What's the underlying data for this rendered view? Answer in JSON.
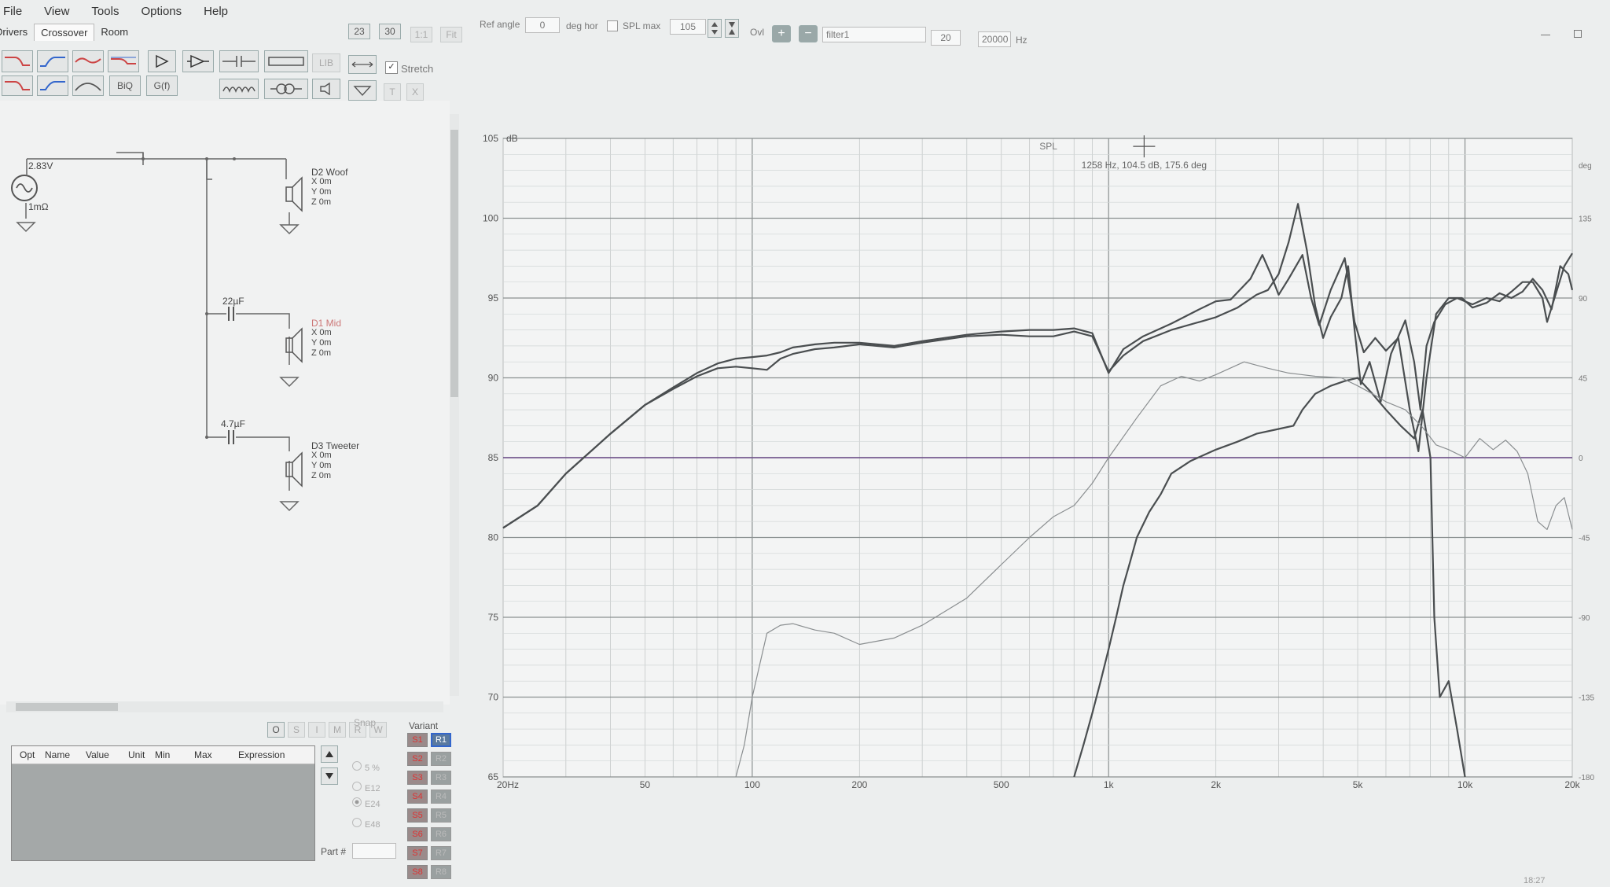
{
  "menu": [
    "File",
    "View",
    "Tools",
    "Options",
    "Help"
  ],
  "tabs": [
    "Drivers",
    "Crossover",
    "Room"
  ],
  "zoom_buttons": [
    "23",
    "30",
    "1:1",
    "Fit"
  ],
  "toolbar": {
    "biq": "BiQ",
    "gf": "G(f)",
    "lib": "LIB",
    "stretch": "Stretch",
    "t": "T",
    "x": "X"
  },
  "topbar": {
    "ref_angle_label": "Ref angle",
    "ref_angle": "0",
    "deg_hor": "deg hor",
    "spl_max_label": "SPL max",
    "spl_max": "105",
    "ovl": "Ovl",
    "filter": "filter1",
    "f_min": "20",
    "f_max": "20000",
    "hz": "Hz"
  },
  "schematic": {
    "source_v": "2.83V",
    "source_r": "1mΩ",
    "woof": {
      "name": "D2 Woof",
      "x": "X 0m",
      "y": "Y 0m",
      "z": "Z 0m"
    },
    "mid": {
      "name": "D1 Mid",
      "x": "X 0m",
      "y": "Y 0m",
      "z": "Z 0m",
      "cap": "22µF"
    },
    "tweet": {
      "name": "D3 Tweeter",
      "x": "X 0m",
      "y": "Y 0m",
      "z": "Z 0m",
      "cap": "4.7µF"
    }
  },
  "param_table": {
    "headers": [
      "Opt",
      "Name",
      "Value",
      "Unit",
      "Min",
      "Max",
      "Expression"
    ],
    "part_label": "Part #"
  },
  "snap": {
    "label": "Snap",
    "options": [
      "5 %",
      "E12",
      "E24",
      "E48"
    ],
    "selected": "E24"
  },
  "variant": {
    "label": "Variant",
    "s": [
      "S1",
      "S2",
      "S3",
      "S4",
      "S5",
      "S6",
      "S7",
      "S8"
    ],
    "r": [
      "R1",
      "R2",
      "R3",
      "R4",
      "R5",
      "R6",
      "R7",
      "R8"
    ]
  },
  "small_buttons": [
    "O",
    "S",
    "I",
    "M",
    "R",
    "W"
  ],
  "clock": "18:27",
  "colors": {
    "grid": "#9aa0a0",
    "trace_dark": "#4a4e50",
    "trace_light": "#8a8e90",
    "phase_line": "#6a4a88"
  },
  "chart_data": {
    "type": "line",
    "title": "SPL",
    "ylabel": "dB",
    "y2label": "deg",
    "xscale": "log",
    "xlim": [
      20,
      20000
    ],
    "ylim": [
      65,
      105
    ],
    "y2lim": [
      -180,
      180
    ],
    "x_ticks": [
      "20Hz",
      "50",
      "100",
      "200",
      "500",
      "1k",
      "2k",
      "5k",
      "10k",
      "20k"
    ],
    "y_ticks": [
      65,
      70,
      75,
      80,
      85,
      90,
      95,
      100,
      105
    ],
    "y2_ticks": [
      "-180",
      "-135",
      "-90",
      "-45",
      "0",
      "45",
      "90",
      "135",
      "deg"
    ],
    "cursor_readout": "1258 Hz, 104.5 dB, 175.6 deg",
    "cursor": {
      "freq": 1258,
      "db": 104.5
    },
    "grid": true,
    "series": [
      {
        "role": "spl_total_a",
        "style": "dark",
        "points": [
          [
            20,
            80.6
          ],
          [
            25,
            82
          ],
          [
            30,
            84
          ],
          [
            40,
            86.5
          ],
          [
            50,
            88.3
          ],
          [
            60,
            89.3
          ],
          [
            70,
            90.1
          ],
          [
            80,
            90.6
          ],
          [
            90,
            90.7
          ],
          [
            100,
            90.6
          ],
          [
            110,
            90.5
          ],
          [
            120,
            91.2
          ],
          [
            130,
            91.5
          ],
          [
            150,
            91.8
          ],
          [
            170,
            91.9
          ],
          [
            200,
            92.1
          ],
          [
            250,
            91.9
          ],
          [
            300,
            92.2
          ],
          [
            400,
            92.6
          ],
          [
            500,
            92.7
          ],
          [
            600,
            92.6
          ],
          [
            700,
            92.6
          ],
          [
            800,
            92.9
          ],
          [
            900,
            92.6
          ],
          [
            1000,
            90.4
          ],
          [
            1100,
            91.4
          ],
          [
            1250,
            92.3
          ],
          [
            1500,
            93
          ],
          [
            1800,
            93.5
          ],
          [
            2000,
            93.8
          ],
          [
            2300,
            94.4
          ],
          [
            2600,
            95.2
          ],
          [
            2800,
            95.5
          ],
          [
            3000,
            96.5
          ],
          [
            3200,
            98.5
          ],
          [
            3400,
            100.9
          ],
          [
            3600,
            98
          ],
          [
            3800,
            94.5
          ],
          [
            4000,
            92.5
          ],
          [
            4200,
            93.8
          ],
          [
            4500,
            95
          ],
          [
            4700,
            97
          ],
          [
            4900,
            93
          ],
          [
            5100,
            89.6
          ],
          [
            5400,
            91
          ],
          [
            5800,
            88.5
          ],
          [
            6200,
            91.5
          ],
          [
            6800,
            93.6
          ],
          [
            7200,
            91
          ],
          [
            7500,
            88
          ],
          [
            7800,
            92
          ],
          [
            8200,
            93.5
          ],
          [
            8800,
            94.6
          ],
          [
            9500,
            95
          ],
          [
            10500,
            94.6
          ],
          [
            11500,
            95
          ],
          [
            12500,
            94.8
          ],
          [
            13500,
            95.4
          ],
          [
            14500,
            96
          ],
          [
            15500,
            96
          ],
          [
            16500,
            95
          ],
          [
            17000,
            93.5
          ],
          [
            18000,
            95.3
          ],
          [
            19000,
            97
          ],
          [
            20000,
            97.8
          ]
        ]
      },
      {
        "role": "spl_total_b",
        "style": "dark",
        "points": [
          [
            20,
            80.6
          ],
          [
            25,
            82
          ],
          [
            30,
            84
          ],
          [
            40,
            86.5
          ],
          [
            50,
            88.3
          ],
          [
            60,
            89.4
          ],
          [
            70,
            90.3
          ],
          [
            80,
            90.9
          ],
          [
            90,
            91.2
          ],
          [
            100,
            91.3
          ],
          [
            110,
            91.4
          ],
          [
            120,
            91.6
          ],
          [
            130,
            91.9
          ],
          [
            150,
            92.1
          ],
          [
            170,
            92.2
          ],
          [
            200,
            92.2
          ],
          [
            250,
            92
          ],
          [
            300,
            92.3
          ],
          [
            400,
            92.7
          ],
          [
            500,
            92.9
          ],
          [
            600,
            93
          ],
          [
            700,
            93
          ],
          [
            800,
            93.1
          ],
          [
            900,
            92.8
          ],
          [
            1000,
            90.3
          ],
          [
            1100,
            91.8
          ],
          [
            1250,
            92.6
          ],
          [
            1500,
            93.4
          ],
          [
            1800,
            94.3
          ],
          [
            2000,
            94.8
          ],
          [
            2200,
            94.9
          ],
          [
            2500,
            96.2
          ],
          [
            2700,
            97.7
          ],
          [
            2850,
            96.5
          ],
          [
            3000,
            95.2
          ],
          [
            3200,
            96.2
          ],
          [
            3500,
            97.7
          ],
          [
            3700,
            95
          ],
          [
            3900,
            93.3
          ],
          [
            4200,
            95.5
          ],
          [
            4600,
            97.5
          ],
          [
            4900,
            93.5
          ],
          [
            5200,
            91.6
          ],
          [
            5600,
            92.5
          ],
          [
            6000,
            91.7
          ],
          [
            6500,
            92.5
          ],
          [
            7000,
            88
          ],
          [
            7400,
            85.4
          ],
          [
            7800,
            90
          ],
          [
            8300,
            94
          ],
          [
            9000,
            95
          ],
          [
            9800,
            95
          ],
          [
            10500,
            94.4
          ],
          [
            11500,
            94.7
          ],
          [
            12500,
            95.3
          ],
          [
            13500,
            95
          ],
          [
            14500,
            95.4
          ],
          [
            15500,
            96.2
          ],
          [
            16500,
            95.5
          ],
          [
            17500,
            94.3
          ],
          [
            18500,
            97
          ],
          [
            19500,
            96.5
          ],
          [
            20000,
            95.5
          ]
        ]
      },
      {
        "role": "tweeter",
        "style": "dark",
        "points": [
          [
            800,
            65
          ],
          [
            850,
            67
          ],
          [
            900,
            69
          ],
          [
            950,
            71
          ],
          [
            1000,
            73
          ],
          [
            1050,
            75
          ],
          [
            1100,
            77
          ],
          [
            1150,
            78.5
          ],
          [
            1200,
            80
          ],
          [
            1300,
            81.6
          ],
          [
            1400,
            82.7
          ],
          [
            1500,
            84
          ],
          [
            1700,
            84.8
          ],
          [
            2000,
            85.5
          ],
          [
            2300,
            86
          ],
          [
            2600,
            86.5
          ],
          [
            3000,
            86.8
          ],
          [
            3300,
            87
          ],
          [
            3500,
            88
          ],
          [
            3800,
            89
          ],
          [
            4200,
            89.5
          ],
          [
            4600,
            89.8
          ],
          [
            5000,
            90
          ],
          [
            5500,
            89
          ],
          [
            6000,
            88
          ],
          [
            6600,
            87
          ],
          [
            7200,
            86.2
          ],
          [
            7600,
            88
          ],
          [
            8000,
            85
          ],
          [
            8200,
            75
          ],
          [
            8500,
            70
          ],
          [
            9000,
            71
          ],
          [
            9500,
            68
          ],
          [
            10000,
            65
          ]
        ]
      },
      {
        "role": "phase_or_mid",
        "style": "light",
        "points": [
          [
            90,
            65
          ],
          [
            95,
            67
          ],
          [
            100,
            70
          ],
          [
            110,
            74
          ],
          [
            120,
            74.5
          ],
          [
            130,
            74.6
          ],
          [
            150,
            74.2
          ],
          [
            170,
            74
          ],
          [
            200,
            73.3
          ],
          [
            250,
            73.7
          ],
          [
            300,
            74.5
          ],
          [
            400,
            76.2
          ],
          [
            500,
            78.3
          ],
          [
            600,
            80
          ],
          [
            700,
            81.3
          ],
          [
            800,
            82
          ],
          [
            900,
            83.4
          ],
          [
            1000,
            85
          ],
          [
            1200,
            87.5
          ],
          [
            1400,
            89.5
          ],
          [
            1600,
            90.1
          ],
          [
            1800,
            89.8
          ],
          [
            2000,
            90.2
          ],
          [
            2400,
            91
          ],
          [
            2800,
            90.6
          ],
          [
            3200,
            90.3
          ],
          [
            3800,
            90.1
          ],
          [
            4500,
            90
          ],
          [
            5000,
            89.5
          ],
          [
            5500,
            89
          ],
          [
            6000,
            88.5
          ],
          [
            6800,
            88
          ],
          [
            7600,
            86.9
          ],
          [
            8300,
            85.8
          ],
          [
            9000,
            85.5
          ],
          [
            10000,
            85
          ],
          [
            11000,
            86.2
          ],
          [
            12000,
            85.5
          ],
          [
            13000,
            86.1
          ],
          [
            14000,
            85.4
          ],
          [
            15000,
            84
          ],
          [
            16000,
            81
          ],
          [
            17000,
            80.5
          ],
          [
            18000,
            82
          ],
          [
            19000,
            82.5
          ],
          [
            20000,
            80.5
          ]
        ]
      }
    ]
  }
}
